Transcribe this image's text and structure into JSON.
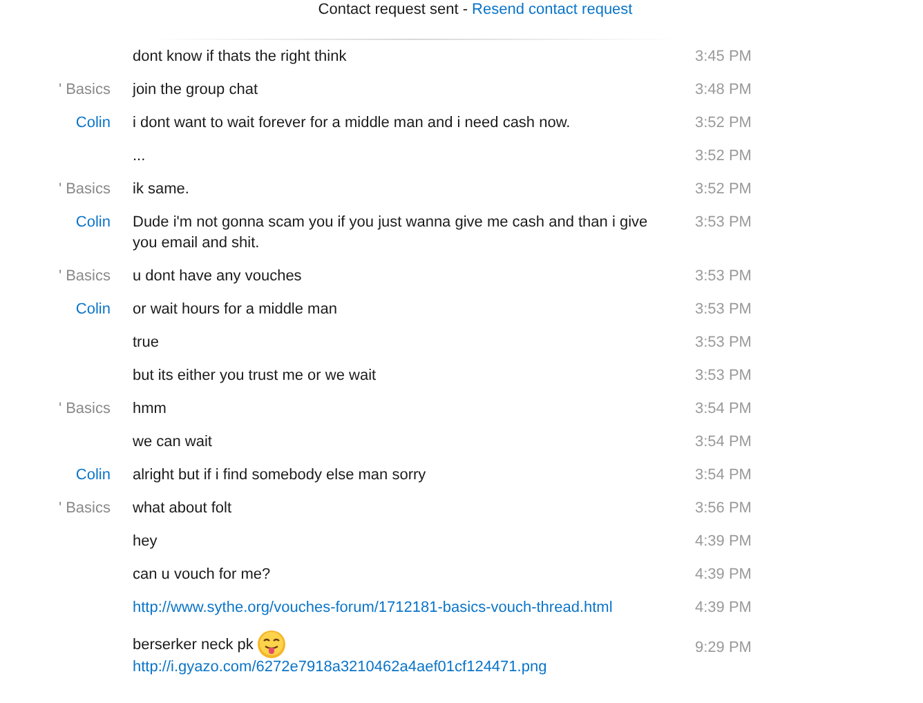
{
  "header": {
    "text": "Contact request sent - ",
    "link": "Resend contact request"
  },
  "messages": [
    {
      "text": "dont know if thats the right think",
      "time": "3:45 PM"
    },
    {
      "sender": "' Basics",
      "color": "#8a8a8a",
      "text": "join the group chat",
      "time": "3:48 PM"
    },
    {
      "sender": "Colin",
      "color": "#0a74c8",
      "text": "i dont want to wait forever for a middle man and i need cash now.",
      "time": "3:52 PM"
    },
    {
      "text": "...",
      "time": "3:52 PM"
    },
    {
      "sender": "' Basics",
      "color": "#8a8a8a",
      "text": "ik same.",
      "time": "3:52 PM"
    },
    {
      "sender": "Colin",
      "color": "#0a74c8",
      "text": "Dude i'm not gonna scam you if you just wanna give me cash and than i give you email and shit.",
      "time": "3:53 PM"
    },
    {
      "sender": "' Basics",
      "color": "#8a8a8a",
      "text": "u dont have any vouches",
      "time": "3:53 PM"
    },
    {
      "sender": "Colin",
      "color": "#0a74c8",
      "text": "or wait hours for a middle man",
      "time": "3:53 PM"
    },
    {
      "text": "true",
      "time": "3:53 PM"
    },
    {
      "text": "but its either you trust me or we wait",
      "time": "3:53 PM"
    },
    {
      "sender": "' Basics",
      "color": "#8a8a8a",
      "text": "hmm",
      "time": "3:54 PM"
    },
    {
      "text": "we can wait",
      "time": "3:54 PM"
    },
    {
      "sender": "Colin",
      "color": "#0a74c8",
      "text": "alright but if i find somebody else man sorry",
      "time": "3:54 PM"
    },
    {
      "sender": "' Basics",
      "color": "#8a8a8a",
      "text": "what about folt",
      "time": "3:56 PM"
    },
    {
      "text": "hey",
      "time": "4:39 PM"
    },
    {
      "text": "can u vouch for me?",
      "time": "4:39 PM"
    },
    {
      "link": "http://www.sythe.org/vouches-forum/1712181-basics-vouch-thread.html",
      "time": "4:39 PM"
    },
    {
      "text": "berserker neck pk",
      "emoji": true,
      "link": "http://i.gyazo.com/6272e7918a3210462a4aef01cf124471.png",
      "time": "9:29 PM"
    }
  ]
}
